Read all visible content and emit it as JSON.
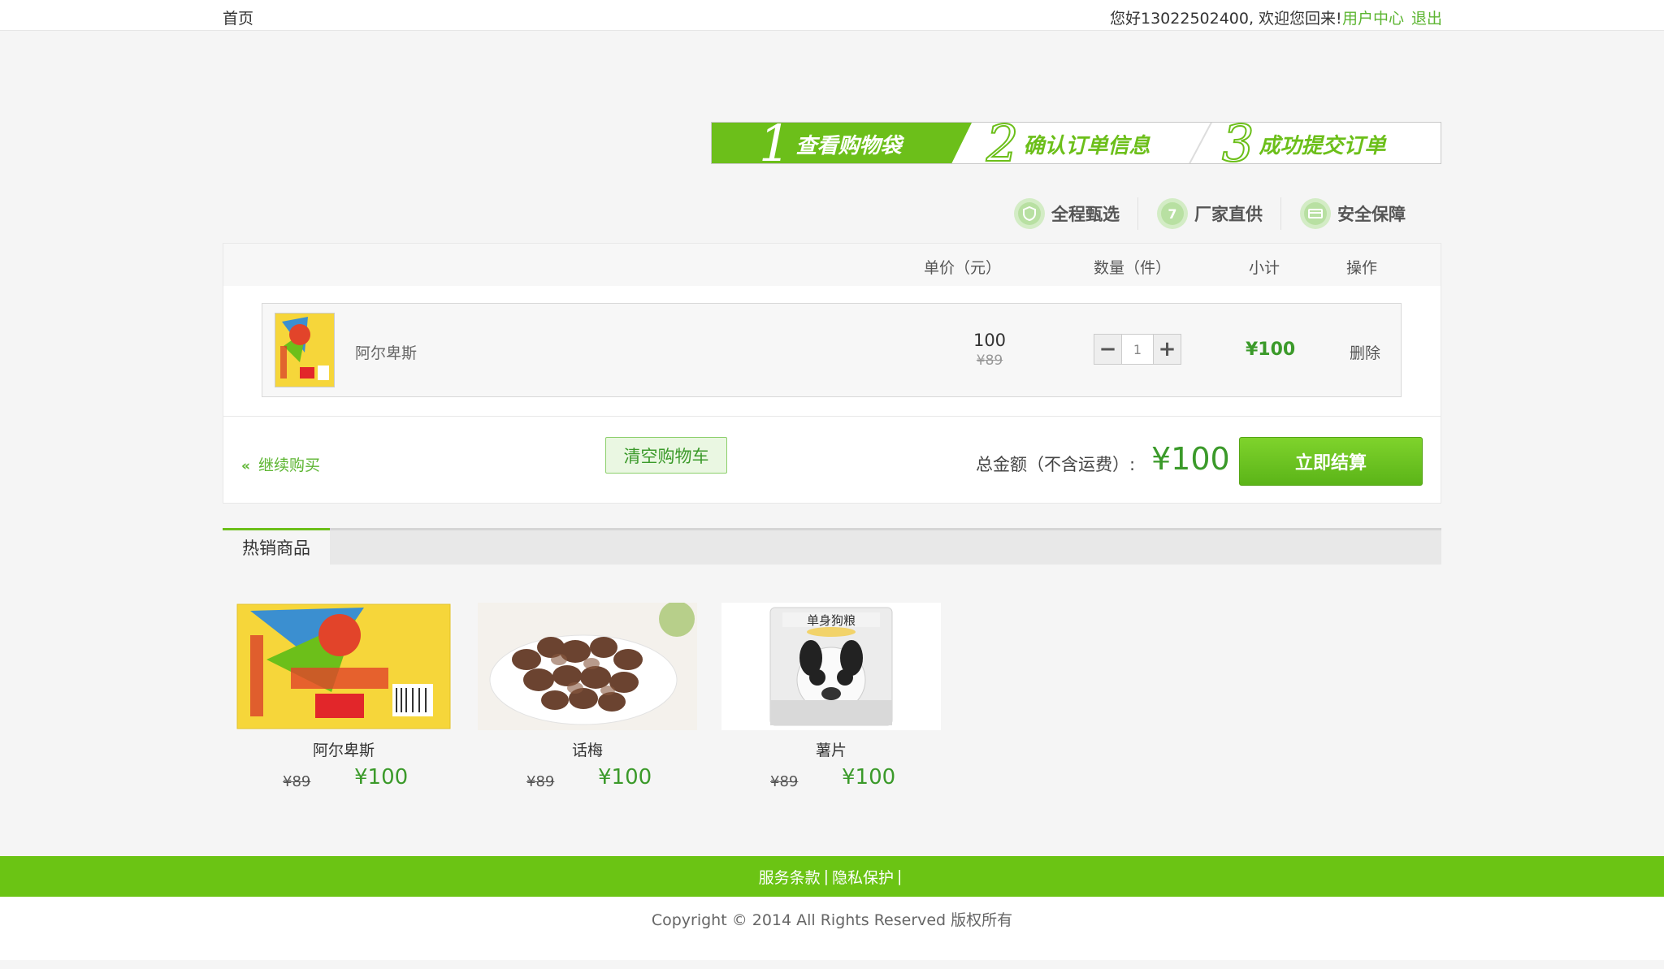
{
  "topbar": {
    "home": "首页",
    "welcome": "您好13022502400, 欢迎您回来!",
    "user_center": "用户中心",
    "logout": "退出"
  },
  "steps": [
    {
      "num": "1",
      "label": "查看购物袋"
    },
    {
      "num": "2",
      "label": "确认订单信息"
    },
    {
      "num": "3",
      "label": "成功提交订单"
    }
  ],
  "guarantees": [
    {
      "icon": "shield-icon",
      "label": "全程甄选"
    },
    {
      "icon": "seven-days-icon",
      "glyph": "7",
      "label": "厂家直供"
    },
    {
      "icon": "secure-card-icon",
      "label": "安全保障"
    }
  ],
  "cart": {
    "headers": {
      "price": "单价（元）",
      "qty": "数量（件）",
      "subtotal": "小计",
      "ops": "操作"
    },
    "items": [
      {
        "name": "阿尔卑斯",
        "price": "100",
        "orig_price": "¥89",
        "qty": "1",
        "subtotal": "¥100",
        "delete": "删除"
      }
    ],
    "continue": "继续购买",
    "clear": "清空购物车",
    "total_label": "总金额（不含运费）:",
    "total": "¥100",
    "checkout": "立即结算"
  },
  "hot": {
    "title": "热销商品",
    "products": [
      {
        "name": "阿尔卑斯",
        "orig": "¥89",
        "price": "¥100"
      },
      {
        "name": "话梅",
        "orig": "¥89",
        "price": "¥100"
      },
      {
        "name": "薯片",
        "orig": "¥89",
        "price": "¥100"
      }
    ]
  },
  "footer": {
    "terms": "服务条款",
    "privacy": "隐私保护",
    "sep": "|",
    "copyright": "Copyright © 2014 All Rights Reserved 版权所有"
  },
  "colors": {
    "accent": "#6cbf1a",
    "price_green": "#3b9a2a"
  }
}
